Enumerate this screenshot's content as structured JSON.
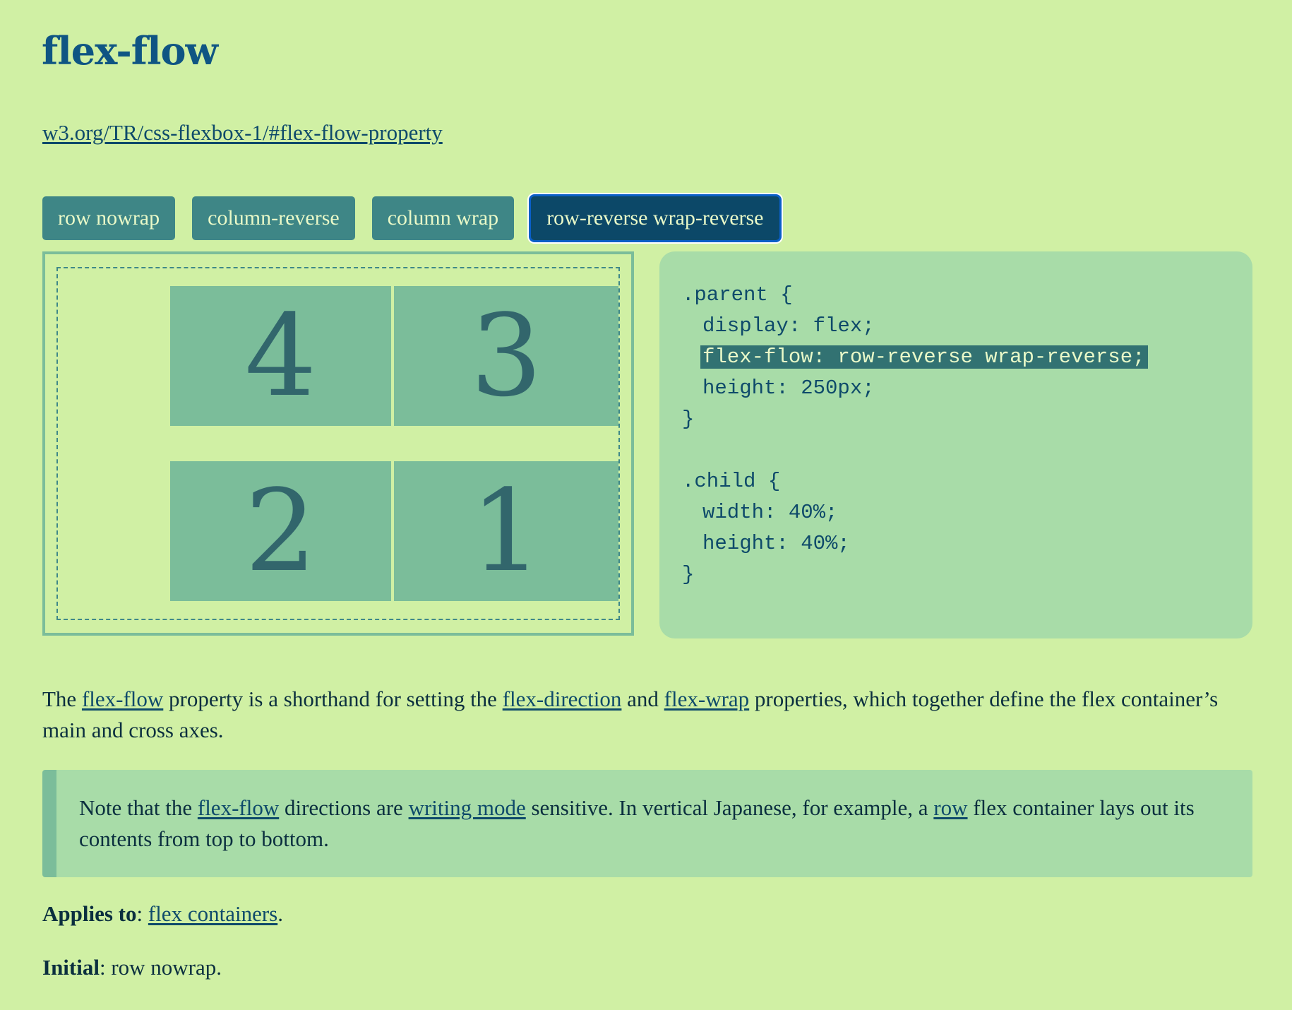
{
  "title": "flex-flow",
  "spec_link": "w3.org/TR/css-flexbox-1/#flex-flow-property",
  "buttons": [
    {
      "label": "row nowrap",
      "active": false
    },
    {
      "label": "column-reverse",
      "active": false
    },
    {
      "label": "column wrap",
      "active": false
    },
    {
      "label": "row-reverse wrap-reverse",
      "active": true
    }
  ],
  "demo": {
    "flex_flow": "row-reverse wrap-reverse",
    "children": [
      "1",
      "2",
      "3",
      "4"
    ]
  },
  "code": {
    "parent_selector": ".parent {",
    "parent_lines": [
      "display: flex;",
      "flex-flow: row-reverse wrap-reverse;",
      "height: 250px;"
    ],
    "close": "}",
    "child_selector": ".child {",
    "child_lines": [
      "width: 40%;",
      "height: 40%;"
    ]
  },
  "paragraph": {
    "t1": "The ",
    "link1": "flex-flow",
    "t2": " property is a shorthand for setting the ",
    "link2": "flex-direction",
    "t3": " and ",
    "link3": "flex-wrap",
    "t4": " properties, which together define the flex container’s main and cross axes."
  },
  "note": {
    "t1": "Note that the ",
    "link1": "flex-flow",
    "t2": " directions are ",
    "link2": "writing mode",
    "t3": " sensitive. In vertical Japanese, for example, a ",
    "link3": "row",
    "t4": " flex container lays out its contents from top to bottom."
  },
  "applies_to": {
    "label": "Applies to",
    "sep": ": ",
    "link": "flex containers",
    "end": "."
  },
  "initial": {
    "label": "Initial",
    "value": ": row nowrap."
  }
}
